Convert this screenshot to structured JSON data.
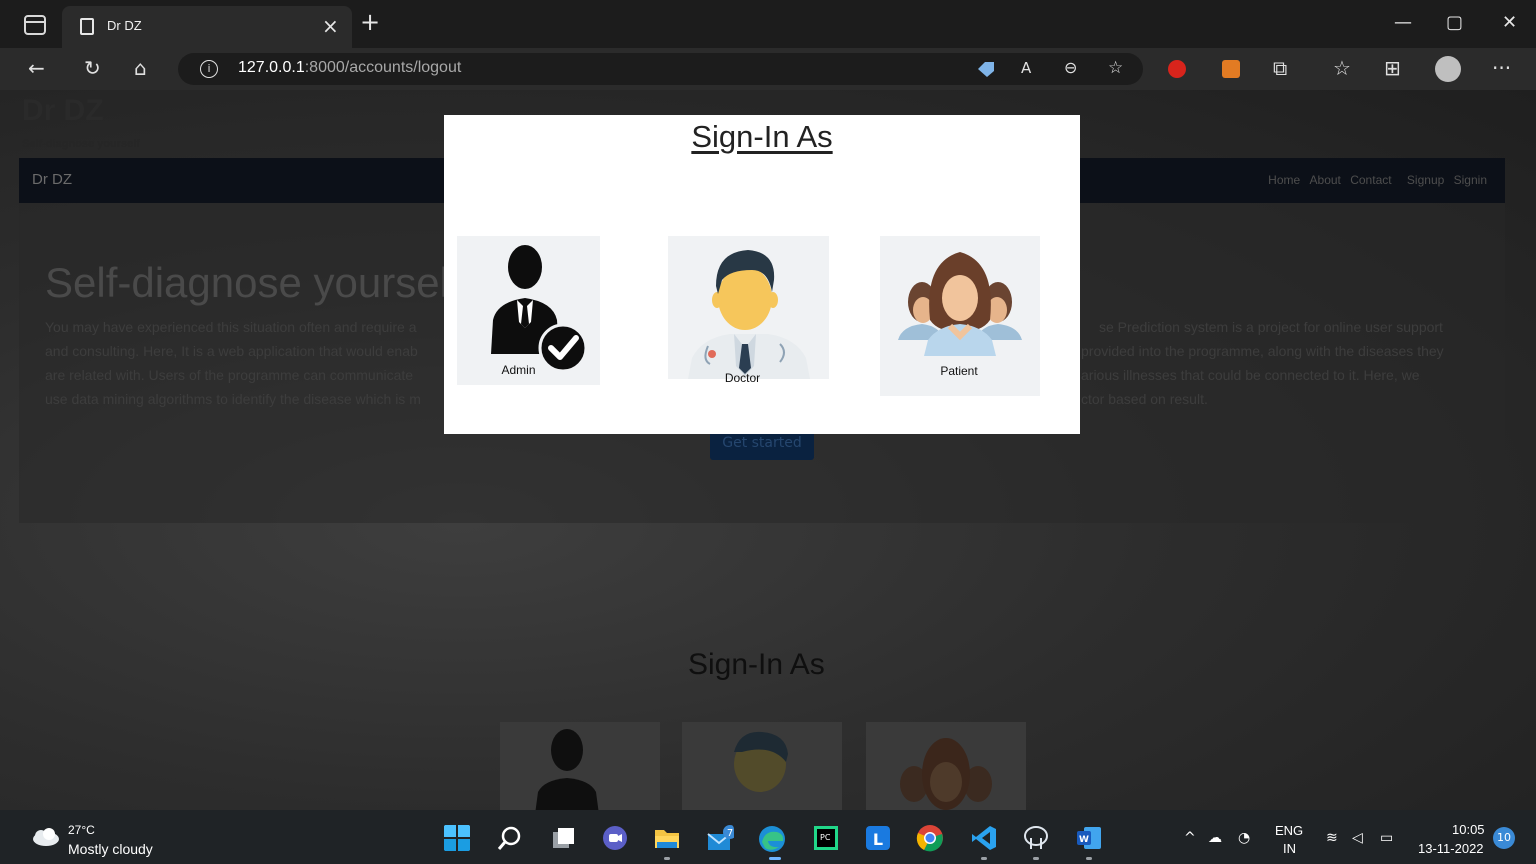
{
  "browser": {
    "tab_title": "Dr DZ",
    "tab_close": "×",
    "new_tab": "+",
    "url_host": "127.0.0.1",
    "url_rest": ":8000/accounts/logout",
    "window_minimize": "—",
    "window_restore": "▢",
    "window_close": "✕",
    "more_menu": "···"
  },
  "page": {
    "site_title": "Dr DZ",
    "site_subtitle": "Self-diagnose yourself",
    "nav_brand": "Dr DZ",
    "nav_links": [
      "Home",
      "About",
      "Contact",
      "Signup",
      "Signin"
    ],
    "hero_heading": "Self-diagnose yourself",
    "hero_left_lines": [
      "You may have experienced this situation often and require a",
      "and consulting. Here, It is a web application that would enab",
      "are related with. Users of the programme can communicate",
      "use data mining algorithms to identify the disease which is m"
    ],
    "hero_right_lines": [
      "se Prediction system is a project for online user support",
      "provided into the programme, along with the diseases they",
      "arious illnesses that could be connected to it. Here, we",
      "ctor based on result."
    ],
    "get_started_label": "Get started",
    "section_heading": "Sign-In As"
  },
  "modal": {
    "title": "Sign-In As",
    "roles": [
      {
        "label": "Admin"
      },
      {
        "label": "Doctor"
      },
      {
        "label": "Patient"
      }
    ]
  },
  "taskbar": {
    "weather_temp": "27°C",
    "weather_desc": "Mostly cloudy",
    "lang_line1": "ENG",
    "lang_line2": "IN",
    "time": "10:05",
    "date": "13-11-2022",
    "notification_count": "10",
    "mail_badge": "7"
  },
  "colors": {
    "modal_bg": "#ffffff",
    "overlay": "#2d2d2d",
    "taskbar_bg": "#1f2326"
  }
}
